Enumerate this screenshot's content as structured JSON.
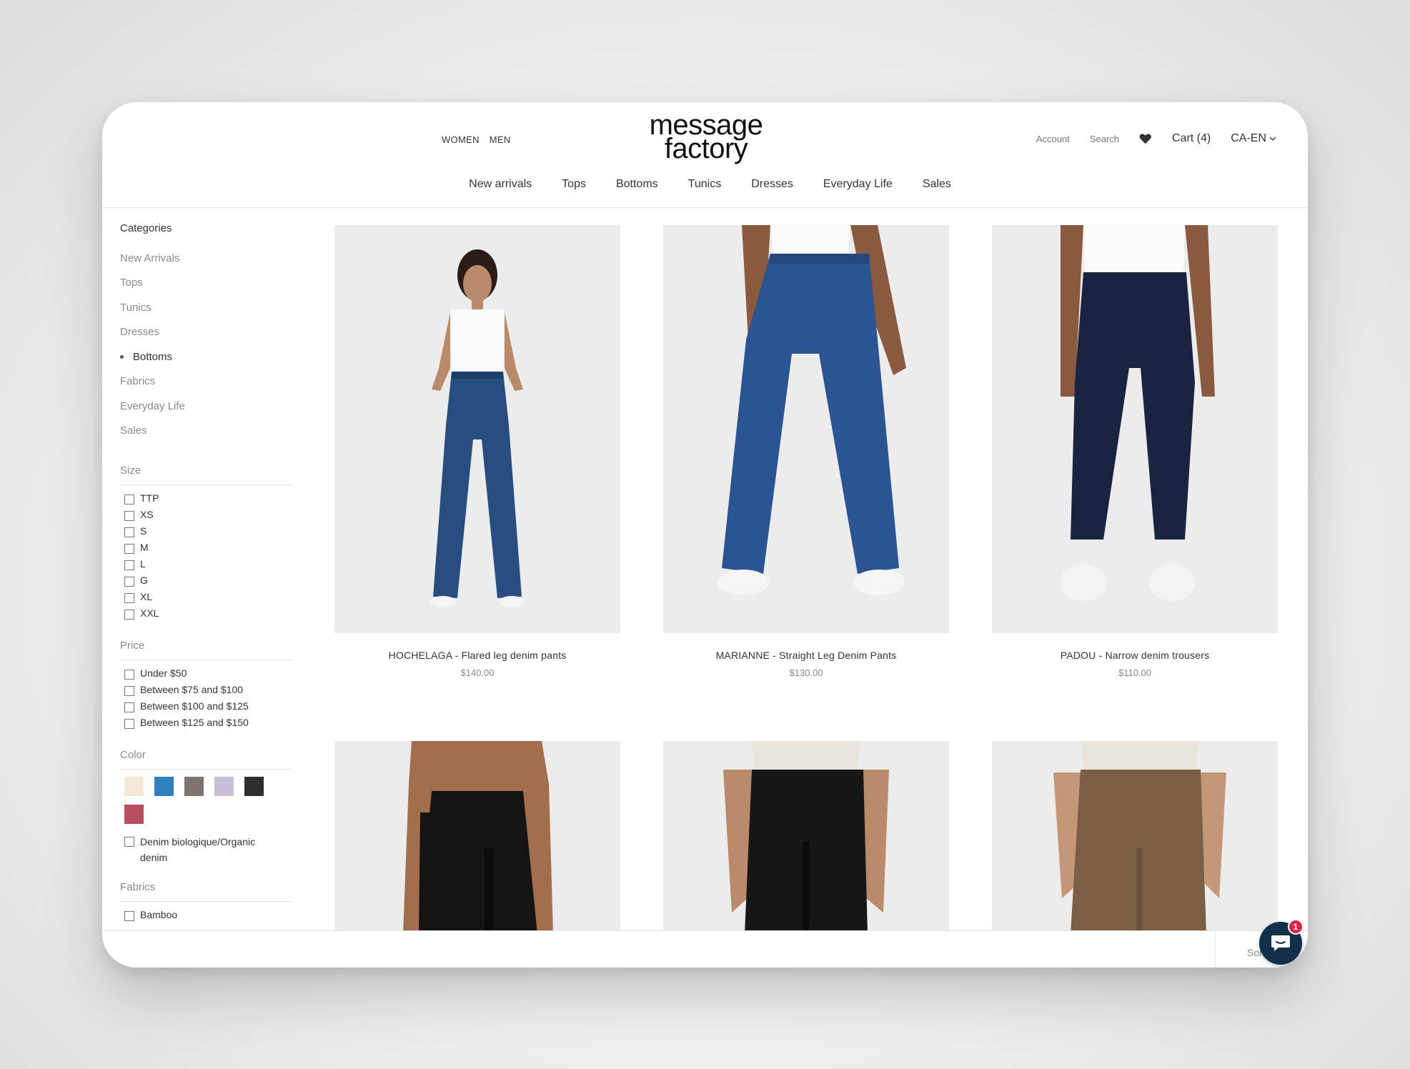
{
  "header": {
    "gender_nav": [
      "WOMEN",
      "MEN"
    ],
    "logo_line1": "message",
    "logo_line2": "factory",
    "account": "Account",
    "search": "Search",
    "cart": "Cart (4)",
    "locale": "CA-EN",
    "main_nav": [
      "New arrivals",
      "Tops",
      "Bottoms",
      "Tunics",
      "Dresses",
      "Everyday Life",
      "Sales"
    ]
  },
  "sidebar": {
    "categories_title": "Categories",
    "categories": [
      "New Arrivals",
      "Tops",
      "Tunics",
      "Dresses",
      "Bottoms",
      "Fabrics",
      "Everyday Life",
      "Sales"
    ],
    "active_category": "Bottoms",
    "size_title": "Size",
    "sizes": [
      "TTP",
      "XS",
      "S",
      "M",
      "L",
      "G",
      "XL",
      "XXL"
    ],
    "price_title": "Price",
    "prices": [
      "Under $50",
      "Between $75 and $100",
      "Between $100 and $125",
      "Between $125 and $150"
    ],
    "color_title": "Color",
    "colors": [
      "#f3ead3",
      "#2f7fbe",
      "#7e746f",
      "#c9bfd9",
      "#2e2e2e",
      "#b84d5f"
    ],
    "color_option": "Denim biologique/Organic denim",
    "fabrics_title": "Fabrics",
    "fabrics": [
      "Bamboo"
    ]
  },
  "products": [
    {
      "name": "HOCHELAGA - Flared leg denim pants",
      "price": "$140.00",
      "color": "#274c7f"
    },
    {
      "name": "MARIANNE - Straight Leg Denim Pants",
      "price": "$130.00",
      "color": "#2a5592"
    },
    {
      "name": "PADOU - Narrow denim trousers",
      "price": "$110.00",
      "color": "#1a2340"
    },
    {
      "name": "",
      "price": "",
      "color": "#141414"
    },
    {
      "name": "",
      "price": "",
      "color": "#161616"
    },
    {
      "name": "",
      "price": "",
      "color": "#7b5f45"
    }
  ],
  "bottom": {
    "sort_label": "Sort",
    "chat_badge": "1"
  }
}
